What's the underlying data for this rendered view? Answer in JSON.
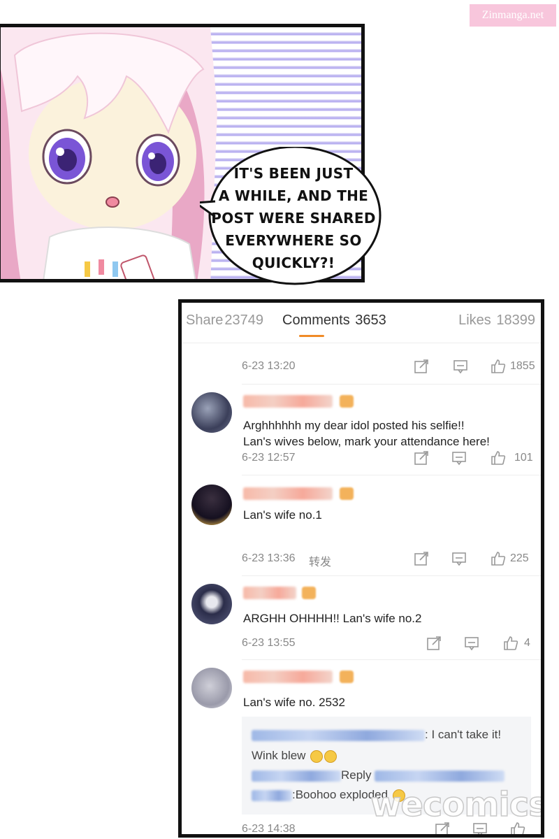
{
  "watermark_top": "Zinmanga.net",
  "panel": {
    "speech_lines": [
      "IT'S BEEN JUST",
      "A WHILE, AND THE",
      "POST WERE SHARED",
      "EVERYWHERE SO",
      "QUICKLY?!"
    ]
  },
  "tabs": {
    "share_label": "Share",
    "share_count": "23749",
    "comments_label": "Comments",
    "comments_count": "3653",
    "likes_label": "Likes",
    "likes_count": "18399"
  },
  "icons": [
    "share-icon",
    "comment-icon",
    "thumbs-up-icon"
  ],
  "accent_color": "#f08b27",
  "top_meta": {
    "time": "6-23 13:20",
    "likes": "1855"
  },
  "comments": [
    {
      "lines": [
        "Arghhhhhh my dear idol posted his selfie!!",
        "Lan's wives below, mark your attendance here!"
      ],
      "time": "6-23 12:57",
      "likes": "101"
    },
    {
      "lines": [
        "Lan's wife no.1"
      ],
      "time": "6-23 13:36",
      "repost": "转发",
      "likes": "225"
    },
    {
      "lines": [
        "ARGHH OHHHH!! Lan's wife no.2"
      ],
      "time": "6-23 13:55",
      "likes": "4"
    },
    {
      "lines": [
        "Lan's wife no. 2532"
      ],
      "time": "6-23 14:38",
      "replies": {
        "line1": ": I can't take it!",
        "line2": "Wink blew",
        "line3": "Reply",
        "line4": ":Boohoo exploded"
      }
    }
  ],
  "watermark_bottom": "wecomics"
}
